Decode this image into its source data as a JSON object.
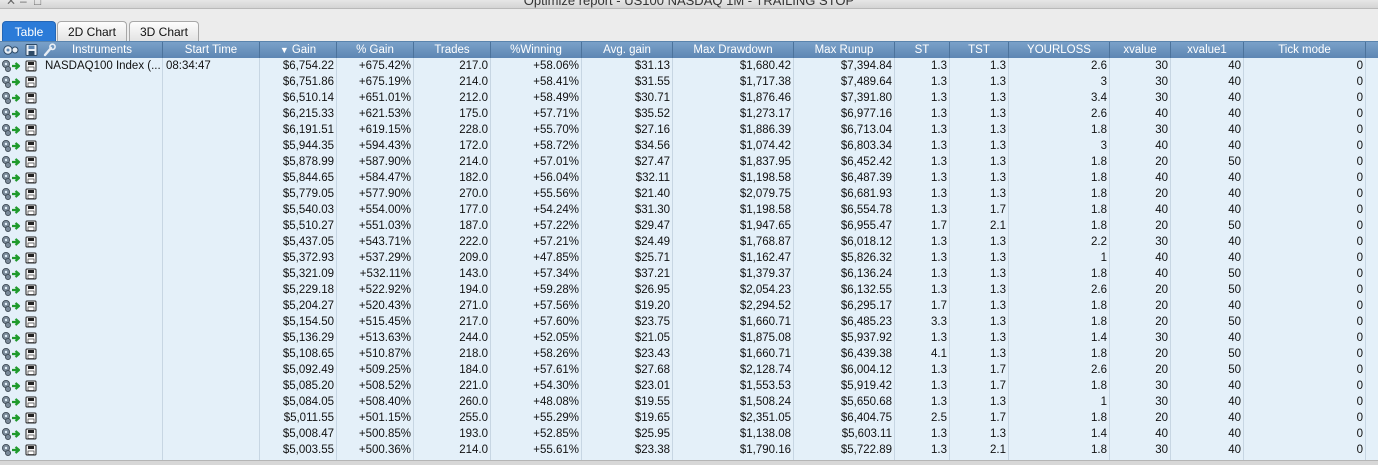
{
  "window": {
    "title": "Optimize report - US100 NASDAQ 1M - TRAILING STOP"
  },
  "tabs": [
    {
      "label": "Table",
      "active": true
    },
    {
      "label": "2D Chart",
      "active": false
    },
    {
      "label": "3D Chart",
      "active": false
    }
  ],
  "colors": {
    "header": "#6a93be",
    "tab_active": "#2b7bd8",
    "grid_bg": "#e4f0f9"
  },
  "icons": {
    "row": [
      "gears-arrow-icon",
      "save-icon"
    ],
    "header": [
      "settings-icon",
      "save-icon",
      "wrench-icon"
    ]
  },
  "columns": [
    "Instruments",
    "Start Time",
    "Gain",
    "% Gain",
    "Trades",
    "%Winning",
    "Avg. gain",
    "Max Drawdown",
    "Max Runup",
    "ST",
    "TST",
    "YOURLOSS",
    "xvalue",
    "xvalue1",
    "Tick mode"
  ],
  "sort_indicator": "▼",
  "rows": [
    [
      "NASDAQ100 Index (...",
      "08:34:47",
      "$6,754.22",
      "+675.42%",
      "217.0",
      "+58.06%",
      "$31.13",
      "$1,680.42",
      "$7,394.84",
      "1.3",
      "1.3",
      "2.6",
      "30",
      "40",
      "0"
    ],
    [
      "",
      "",
      "$6,751.86",
      "+675.19%",
      "214.0",
      "+58.41%",
      "$31.55",
      "$1,717.38",
      "$7,489.64",
      "1.3",
      "1.3",
      "3",
      "30",
      "40",
      "0"
    ],
    [
      "",
      "",
      "$6,510.14",
      "+651.01%",
      "212.0",
      "+58.49%",
      "$30.71",
      "$1,876.46",
      "$7,391.80",
      "1.3",
      "1.3",
      "3.4",
      "30",
      "40",
      "0"
    ],
    [
      "",
      "",
      "$6,215.33",
      "+621.53%",
      "175.0",
      "+57.71%",
      "$35.52",
      "$1,273.17",
      "$6,977.16",
      "1.3",
      "1.3",
      "2.6",
      "40",
      "40",
      "0"
    ],
    [
      "",
      "",
      "$6,191.51",
      "+619.15%",
      "228.0",
      "+55.70%",
      "$27.16",
      "$1,886.39",
      "$6,713.04",
      "1.3",
      "1.3",
      "1.8",
      "30",
      "40",
      "0"
    ],
    [
      "",
      "",
      "$5,944.35",
      "+594.43%",
      "172.0",
      "+58.72%",
      "$34.56",
      "$1,074.42",
      "$6,803.34",
      "1.3",
      "1.3",
      "3",
      "40",
      "40",
      "0"
    ],
    [
      "",
      "",
      "$5,878.99",
      "+587.90%",
      "214.0",
      "+57.01%",
      "$27.47",
      "$1,837.95",
      "$6,452.42",
      "1.3",
      "1.3",
      "1.8",
      "20",
      "50",
      "0"
    ],
    [
      "",
      "",
      "$5,844.65",
      "+584.47%",
      "182.0",
      "+56.04%",
      "$32.11",
      "$1,198.58",
      "$6,487.39",
      "1.3",
      "1.3",
      "1.8",
      "40",
      "40",
      "0"
    ],
    [
      "",
      "",
      "$5,779.05",
      "+577.90%",
      "270.0",
      "+55.56%",
      "$21.40",
      "$2,079.75",
      "$6,681.93",
      "1.3",
      "1.3",
      "1.8",
      "20",
      "40",
      "0"
    ],
    [
      "",
      "",
      "$5,540.03",
      "+554.00%",
      "177.0",
      "+54.24%",
      "$31.30",
      "$1,198.58",
      "$6,554.78",
      "1.3",
      "1.7",
      "1.8",
      "40",
      "40",
      "0"
    ],
    [
      "",
      "",
      "$5,510.27",
      "+551.03%",
      "187.0",
      "+57.22%",
      "$29.47",
      "$1,947.65",
      "$6,955.47",
      "1.7",
      "2.1",
      "1.8",
      "20",
      "50",
      "0"
    ],
    [
      "",
      "",
      "$5,437.05",
      "+543.71%",
      "222.0",
      "+57.21%",
      "$24.49",
      "$1,768.87",
      "$6,018.12",
      "1.3",
      "1.3",
      "2.2",
      "30",
      "40",
      "0"
    ],
    [
      "",
      "",
      "$5,372.93",
      "+537.29%",
      "209.0",
      "+47.85%",
      "$25.71",
      "$1,162.47",
      "$5,826.32",
      "1.3",
      "1.3",
      "1",
      "40",
      "40",
      "0"
    ],
    [
      "",
      "",
      "$5,321.09",
      "+532.11%",
      "143.0",
      "+57.34%",
      "$37.21",
      "$1,379.37",
      "$6,136.24",
      "1.3",
      "1.3",
      "1.8",
      "40",
      "50",
      "0"
    ],
    [
      "",
      "",
      "$5,229.18",
      "+522.92%",
      "194.0",
      "+59.28%",
      "$26.95",
      "$2,054.23",
      "$6,132.55",
      "1.3",
      "1.3",
      "2.6",
      "20",
      "50",
      "0"
    ],
    [
      "",
      "",
      "$5,204.27",
      "+520.43%",
      "271.0",
      "+57.56%",
      "$19.20",
      "$2,294.52",
      "$6,295.17",
      "1.7",
      "1.3",
      "1.8",
      "20",
      "40",
      "0"
    ],
    [
      "",
      "",
      "$5,154.50",
      "+515.45%",
      "217.0",
      "+57.60%",
      "$23.75",
      "$1,660.71",
      "$6,485.23",
      "3.3",
      "1.3",
      "1.8",
      "20",
      "50",
      "0"
    ],
    [
      "",
      "",
      "$5,136.29",
      "+513.63%",
      "244.0",
      "+52.05%",
      "$21.05",
      "$1,875.08",
      "$5,937.92",
      "1.3",
      "1.3",
      "1.4",
      "30",
      "40",
      "0"
    ],
    [
      "",
      "",
      "$5,108.65",
      "+510.87%",
      "218.0",
      "+58.26%",
      "$23.43",
      "$1,660.71",
      "$6,439.38",
      "4.1",
      "1.3",
      "1.8",
      "20",
      "50",
      "0"
    ],
    [
      "",
      "",
      "$5,092.49",
      "+509.25%",
      "184.0",
      "+57.61%",
      "$27.68",
      "$2,128.74",
      "$6,004.12",
      "1.3",
      "1.7",
      "2.6",
      "20",
      "50",
      "0"
    ],
    [
      "",
      "",
      "$5,085.20",
      "+508.52%",
      "221.0",
      "+54.30%",
      "$23.01",
      "$1,553.53",
      "$5,919.42",
      "1.3",
      "1.7",
      "1.8",
      "30",
      "40",
      "0"
    ],
    [
      "",
      "",
      "$5,084.05",
      "+508.40%",
      "260.0",
      "+48.08%",
      "$19.55",
      "$1,508.24",
      "$5,650.68",
      "1.3",
      "1.3",
      "1",
      "30",
      "40",
      "0"
    ],
    [
      "",
      "",
      "$5,011.55",
      "+501.15%",
      "255.0",
      "+55.29%",
      "$19.65",
      "$2,351.05",
      "$6,404.75",
      "2.5",
      "1.7",
      "1.8",
      "20",
      "40",
      "0"
    ],
    [
      "",
      "",
      "$5,008.47",
      "+500.85%",
      "193.0",
      "+52.85%",
      "$25.95",
      "$1,138.08",
      "$5,603.11",
      "1.3",
      "1.3",
      "1.4",
      "40",
      "40",
      "0"
    ],
    [
      "",
      "",
      "$5,003.55",
      "+500.36%",
      "214.0",
      "+55.61%",
      "$23.38",
      "$1,790.16",
      "$5,722.89",
      "1.3",
      "2.1",
      "1.8",
      "30",
      "40",
      "0"
    ]
  ]
}
